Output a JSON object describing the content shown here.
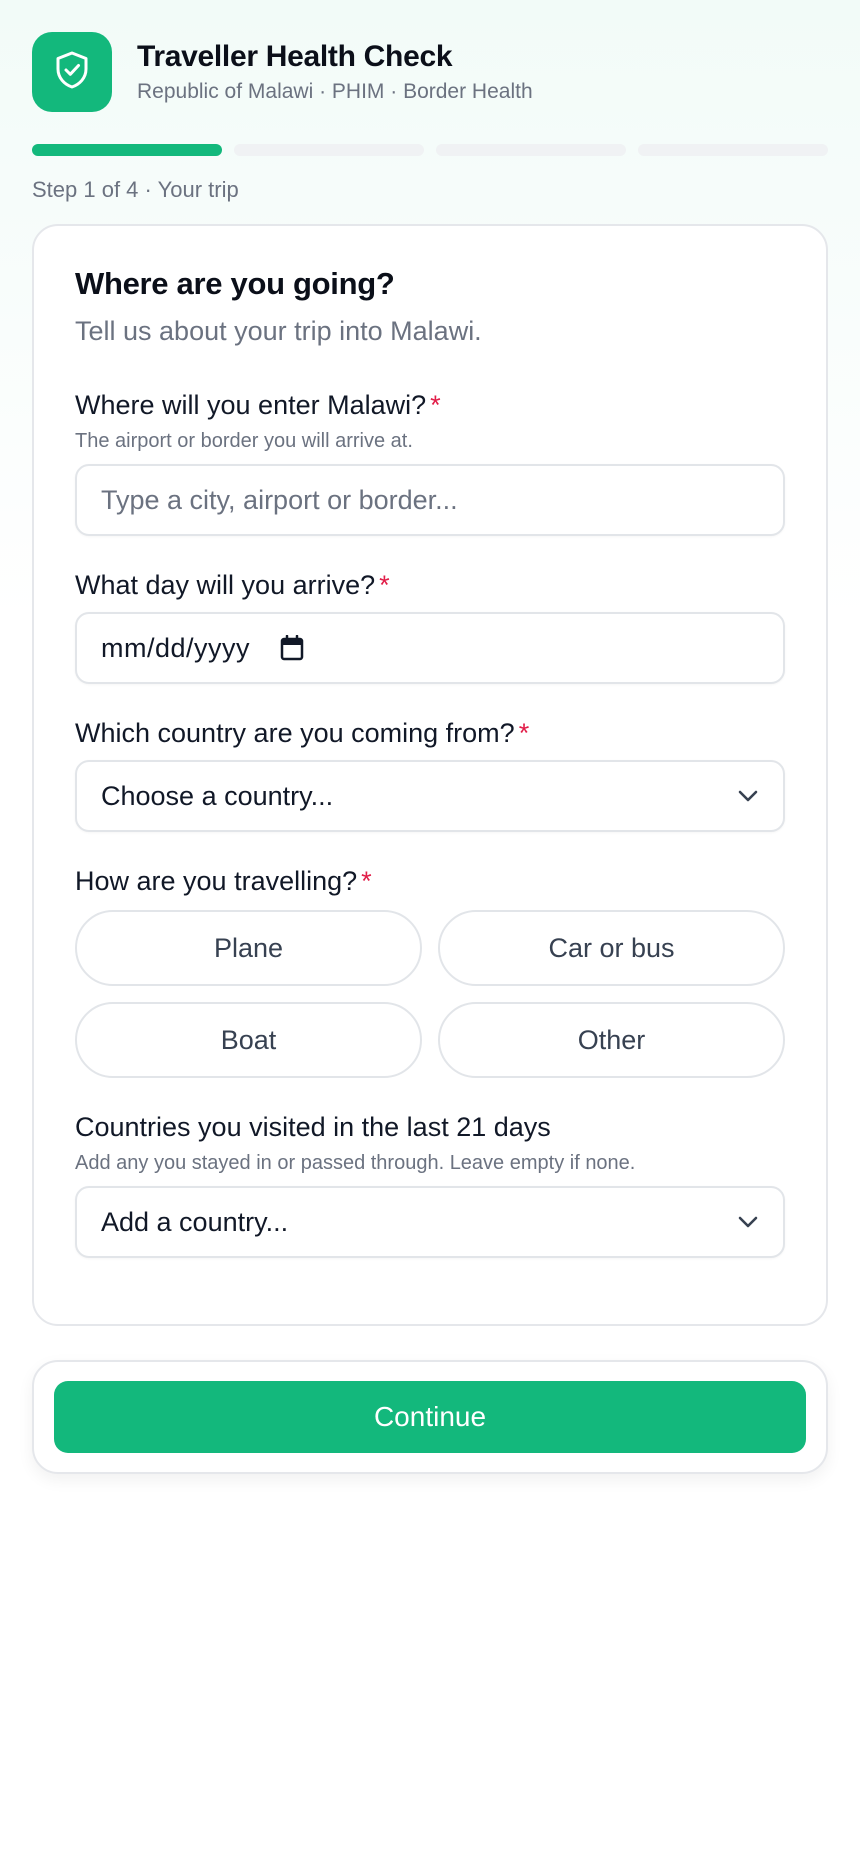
{
  "header": {
    "title": "Traveller Health Check",
    "subtitle": "Republic of Malawi · PHIM · Border Health",
    "logo_icon": "shield-check-icon"
  },
  "progress": {
    "current_step": 1,
    "total_steps": 4,
    "label": "Step 1 of 4 · Your trip"
  },
  "card": {
    "title": "Where are you going?",
    "subtitle": "Tell us about your trip into Malawi."
  },
  "fields": {
    "entry_point": {
      "label": "Where will you enter Malawi?",
      "required_mark": "*",
      "hint": "The airport or border you will arrive at.",
      "placeholder": "Type a city, airport or border...",
      "value": ""
    },
    "arrival_date": {
      "label": "What day will you arrive?",
      "required_mark": "*",
      "value": "mm/dd/yyyy",
      "icon": "calendar-icon"
    },
    "origin_country": {
      "label": "Which country are you coming from?",
      "required_mark": "*",
      "value": "Choose a country...",
      "icon": "chevron-down-icon"
    },
    "travel_mode": {
      "label": "How are you travelling?",
      "required_mark": "*",
      "options": [
        "Plane",
        "Car or bus",
        "Boat",
        "Other"
      ],
      "selected": null
    },
    "visited_countries": {
      "label": "Countries you visited in the last 21 days",
      "hint": "Add any you stayed in or passed through. Leave empty if none.",
      "value": "Add a country...",
      "icon": "chevron-down-icon"
    }
  },
  "footer": {
    "continue_label": "Continue"
  },
  "colors": {
    "accent": "#13b87c",
    "required": "#e11d48",
    "muted_text": "#6b7280",
    "border": "#e2e5e9"
  }
}
